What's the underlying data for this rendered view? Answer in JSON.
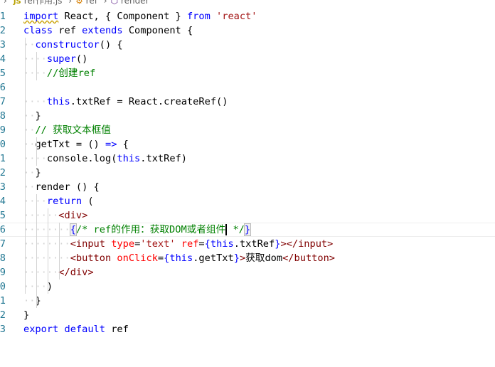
{
  "breadcrumb": {
    "file": "ref作用.js",
    "file_icon": "JS",
    "items": [
      "ref",
      "render"
    ],
    "render_icon": "cube-icon"
  },
  "editor": {
    "current_line": 16,
    "lines": [
      {
        "n": "1",
        "t": [
          [
            "import",
            "kw sq"
          ],
          [
            " React, { Component } ",
            "id"
          ],
          [
            "from",
            "kw"
          ],
          [
            " ",
            ""
          ],
          [
            "'react'",
            "str"
          ]
        ]
      },
      {
        "n": "2",
        "t": [
          [
            "class",
            "kw"
          ],
          [
            " ref ",
            "id"
          ],
          [
            "extends",
            "kw"
          ],
          [
            " Component {",
            "id"
          ]
        ]
      },
      {
        "n": "3",
        "t": [
          [
            "  ",
            "ws"
          ],
          [
            "constructor",
            "kw"
          ],
          [
            "() {",
            "id"
          ]
        ]
      },
      {
        "n": "4",
        "t": [
          [
            "    ",
            "ws"
          ],
          [
            "super",
            "kw"
          ],
          [
            "()",
            "id"
          ]
        ]
      },
      {
        "n": "5",
        "t": [
          [
            "    ",
            "ws"
          ],
          [
            "//创建ref",
            "cm"
          ]
        ]
      },
      {
        "n": "6",
        "t": []
      },
      {
        "n": "7",
        "t": [
          [
            "    ",
            "ws"
          ],
          [
            "this",
            "kw"
          ],
          [
            ".txtRef = React.createRef()",
            "id"
          ]
        ]
      },
      {
        "n": "8",
        "t": [
          [
            "  ",
            "ws"
          ],
          [
            "}",
            "id"
          ]
        ]
      },
      {
        "n": "9",
        "t": [
          [
            "  ",
            "ws"
          ],
          [
            "// 获取文本框值",
            "cm"
          ]
        ]
      },
      {
        "n": "0",
        "t": [
          [
            "  ",
            "ws"
          ],
          [
            "getTxt = () ",
            "id"
          ],
          [
            "=>",
            "kw"
          ],
          [
            " {",
            "id"
          ]
        ]
      },
      {
        "n": "1",
        "t": [
          [
            "    ",
            "ws"
          ],
          [
            "console.log(",
            "id"
          ],
          [
            "this",
            "kw"
          ],
          [
            ".txtRef)",
            "id"
          ]
        ]
      },
      {
        "n": "2",
        "t": [
          [
            "  ",
            "ws"
          ],
          [
            "}",
            "id"
          ]
        ]
      },
      {
        "n": "3",
        "t": [
          [
            "  ",
            "ws"
          ],
          [
            "render () {",
            "id"
          ]
        ]
      },
      {
        "n": "4",
        "t": [
          [
            "    ",
            "ws"
          ],
          [
            "return",
            "kw"
          ],
          [
            " (",
            "id"
          ]
        ]
      },
      {
        "n": "5",
        "t": [
          [
            "      ",
            "ws"
          ],
          [
            "<",
            "pn"
          ],
          [
            "div",
            "tag"
          ],
          [
            ">",
            "pn"
          ]
        ]
      },
      {
        "n": "6",
        "t": [
          [
            "        ",
            "ws"
          ],
          [
            "{",
            "br match"
          ],
          [
            "/* ref的作用：获取DOM或者组件",
            "cm"
          ],
          [
            "|",
            "cursor"
          ],
          [
            " */",
            "cm"
          ],
          [
            "}",
            "br match"
          ]
        ]
      },
      {
        "n": "7",
        "t": [
          [
            "        ",
            "ws"
          ],
          [
            "<",
            "pn"
          ],
          [
            "input",
            "tag"
          ],
          [
            " ",
            ""
          ],
          [
            "type",
            "attr"
          ],
          [
            "=",
            "id"
          ],
          [
            "'text'",
            "str"
          ],
          [
            " ",
            ""
          ],
          [
            "ref",
            "attr"
          ],
          [
            "=",
            "id"
          ],
          [
            "{",
            "br"
          ],
          [
            "this",
            "kw"
          ],
          [
            ".txtRef",
            "id"
          ],
          [
            "}",
            "br"
          ],
          [
            "></",
            "pn"
          ],
          [
            "input",
            "tag"
          ],
          [
            ">",
            "pn"
          ]
        ]
      },
      {
        "n": "8",
        "t": [
          [
            "        ",
            "ws"
          ],
          [
            "<",
            "pn"
          ],
          [
            "button",
            "tag"
          ],
          [
            " ",
            ""
          ],
          [
            "onClick",
            "attr"
          ],
          [
            "=",
            "id"
          ],
          [
            "{",
            "br"
          ],
          [
            "this",
            "kw"
          ],
          [
            ".getTxt",
            "id"
          ],
          [
            "}",
            "br"
          ],
          [
            ">",
            "pn"
          ],
          [
            "获取dom",
            "id"
          ],
          [
            "</",
            "pn"
          ],
          [
            "button",
            "tag"
          ],
          [
            ">",
            "pn"
          ]
        ]
      },
      {
        "n": "9",
        "t": [
          [
            "      ",
            "ws"
          ],
          [
            "</",
            "pn"
          ],
          [
            "div",
            "tag"
          ],
          [
            ">",
            "pn"
          ]
        ]
      },
      {
        "n": "0",
        "t": [
          [
            "    ",
            "ws"
          ],
          [
            ")",
            "id"
          ]
        ]
      },
      {
        "n": "1",
        "t": [
          [
            "  ",
            "ws"
          ],
          [
            "}",
            "id"
          ]
        ]
      },
      {
        "n": "2",
        "t": [
          [
            "}",
            "id"
          ]
        ]
      },
      {
        "n": "3",
        "t": [
          [
            "export",
            "kw"
          ],
          [
            " ",
            ""
          ],
          [
            "default",
            "kw"
          ],
          [
            " ref",
            "id"
          ]
        ]
      }
    ]
  }
}
